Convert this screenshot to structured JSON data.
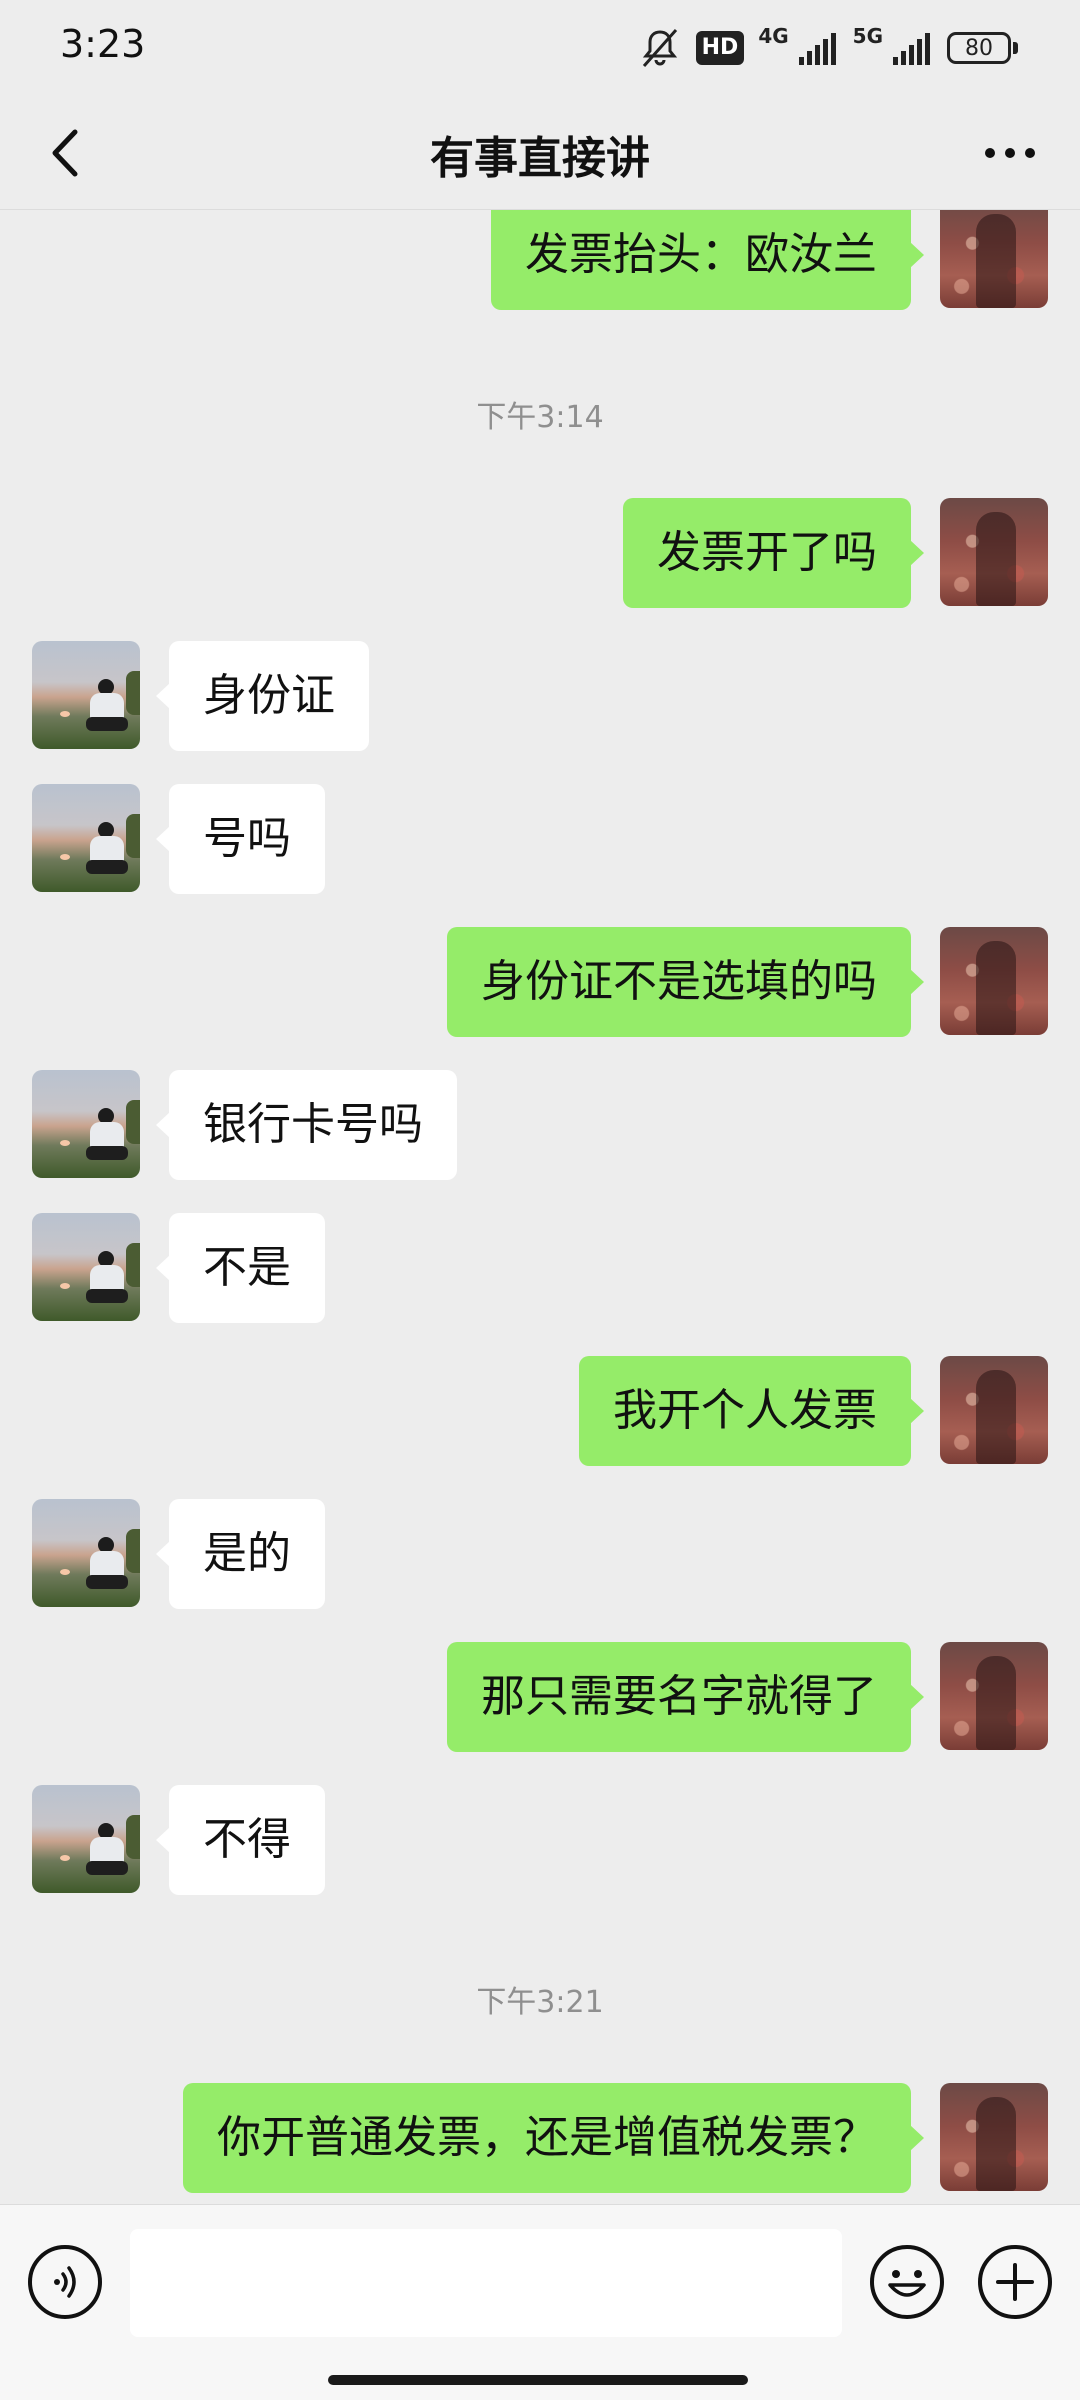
{
  "status_bar": {
    "time": "3:23",
    "hd_label": "HD",
    "net1": "4G",
    "net2": "5G",
    "battery": "80"
  },
  "header": {
    "title": "有事直接讲",
    "back_icon": "chevron-left-icon",
    "more_icon": "more-dots-icon"
  },
  "messages": [
    {
      "side": "out",
      "text": "发票抬头：欧汝兰"
    },
    {
      "type": "time",
      "text": "下午3:14"
    },
    {
      "side": "out",
      "text": "发票开了吗"
    },
    {
      "side": "in",
      "text": "身份证"
    },
    {
      "side": "in",
      "text": "号吗"
    },
    {
      "side": "out",
      "text": "身份证不是选填的吗"
    },
    {
      "side": "in",
      "text": "银行卡号吗"
    },
    {
      "side": "in",
      "text": "不是"
    },
    {
      "side": "out",
      "text": "我开个人发票"
    },
    {
      "side": "in",
      "text": "是的"
    },
    {
      "side": "out",
      "text": "那只需要名字就得了"
    },
    {
      "side": "in",
      "text": "不得"
    },
    {
      "type": "time",
      "text": "下午3:21"
    },
    {
      "side": "out",
      "text": "你开普通发票，还是增值税发票？"
    }
  ],
  "input_bar": {
    "value": "",
    "voice_icon": "voice-icon",
    "emoji_icon": "emoji-icon",
    "plus_icon": "plus-icon"
  },
  "colors": {
    "background": "#ededed",
    "outgoing_bubble": "#95ec69",
    "incoming_bubble": "#ffffff",
    "timestamp": "#8f8f8f"
  }
}
